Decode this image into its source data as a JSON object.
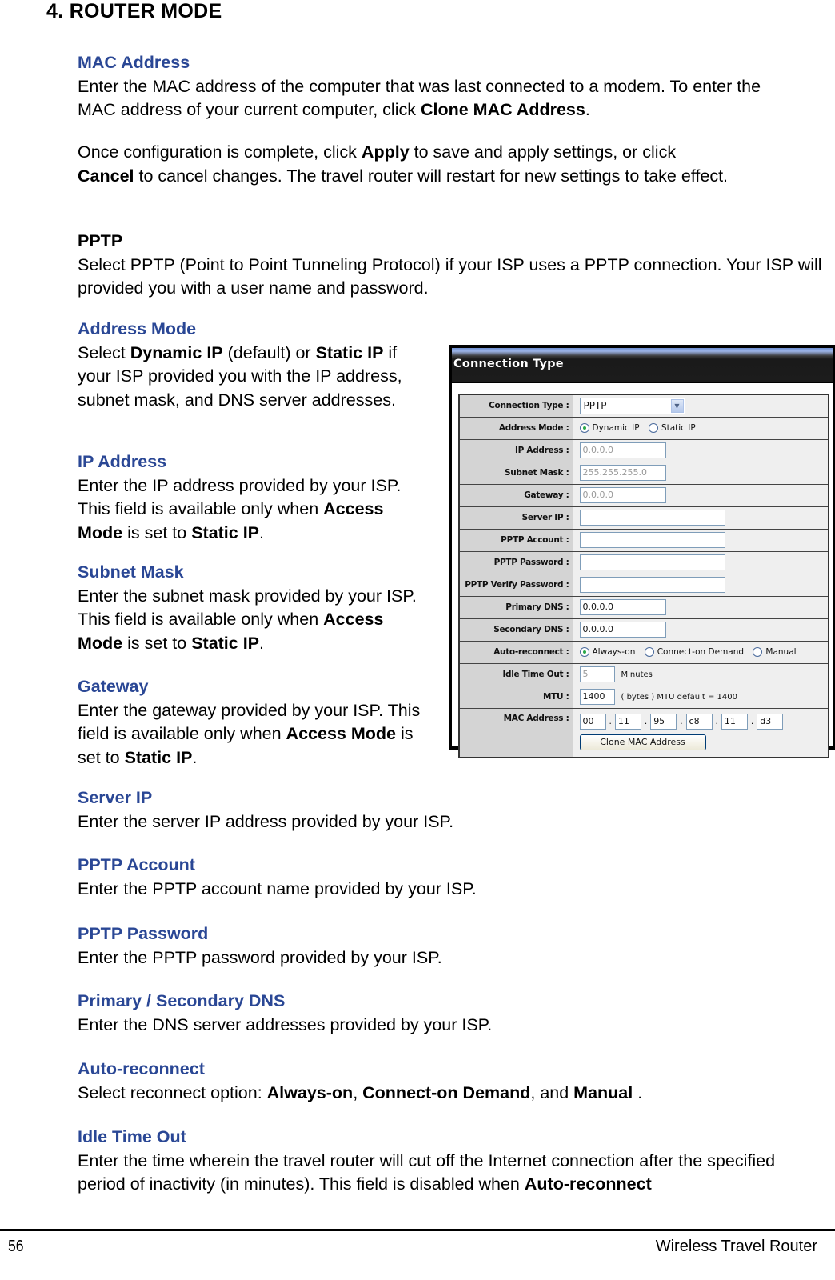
{
  "page_title": "4.  ROUTER MODE",
  "sections": {
    "mac": {
      "heading": "MAC Address",
      "text_1": "Enter the MAC address of the computer that was last connected to a modem. To enter the MAC address of your current computer, click ",
      "bold_1": "Clone MAC Address",
      "text_2": "."
    },
    "apply": {
      "text_1": "Once configuration is complete, click ",
      "bold_1": "Apply",
      "text_2": " to save and apply settings, or click ",
      "bold_2": "Cancel",
      "text_3": " to cancel changes. The travel router will restart for new settings to take effect."
    },
    "pptp": {
      "heading": "PPTP",
      "text": "Select PPTP (Point to Point Tunneling Protocol) if your ISP uses a PPTP connection. Your ISP will provided you with a user name and password."
    },
    "address_mode": {
      "heading": "Address Mode",
      "text_1": "Select ",
      "bold_1": "Dynamic IP",
      "text_2": " (default) or ",
      "bold_2": "Static IP",
      "text_3": " if your ISP provided you with the IP address, subnet mask, and DNS server addresses."
    },
    "ip_address": {
      "heading": "IP Address",
      "text_1": "Enter the IP address provided by your ISP. This field is available only when ",
      "bold_1": "Access Mode",
      "text_2": " is set to ",
      "bold_2": "Static IP",
      "text_3": "."
    },
    "subnet_mask": {
      "heading": "Subnet Mask",
      "text_1": "Enter the subnet mask provided by your ISP. This field is available only when ",
      "bold_1": "Access Mode",
      "text_2": " is set to ",
      "bold_2": "Static IP",
      "text_3": "."
    },
    "gateway": {
      "heading": "Gateway",
      "text_1": "Enter the gateway provided by your ISP. This field is available only when ",
      "bold_1": "Access Mode",
      "text_2": " is set to ",
      "bold_2": "Static IP",
      "text_3": "."
    },
    "server_ip": {
      "heading": "Server IP",
      "text": "Enter the server IP address provided by your ISP."
    },
    "pptp_account": {
      "heading": "PPTP Account",
      "text": "Enter the PPTP account name provided by your ISP."
    },
    "pptp_password": {
      "heading": "PPTP Password",
      "text": "Enter the PPTP password provided by your ISP."
    },
    "dns": {
      "heading": "Primary / Secondary DNS",
      "text": "Enter the DNS server addresses provided by your ISP."
    },
    "auto_reconnect": {
      "heading": "Auto-reconnect",
      "text_1": "Select reconnect option: ",
      "bold_1": "Always-on",
      "text_2": ", ",
      "bold_2": "Connect-on Demand",
      "text_3": ", and ",
      "bold_3": "Manual",
      "text_4": " ."
    },
    "idle_time_out": {
      "heading": "Idle Time Out",
      "text_1": "Enter the time wherein the travel router will cut off the Internet connection after the specified period of inactivity (in minutes). This field is disabled when ",
      "bold_1": "Auto-reconnect"
    }
  },
  "panel": {
    "title": "Connection Type",
    "connection_type": {
      "label": "Connection Type :",
      "value": "PPTP",
      "icon": "chevron-down-icon"
    },
    "address_mode": {
      "label": "Address Mode :",
      "options": [
        "Dynamic IP",
        "Static IP"
      ],
      "selected": "Dynamic IP"
    },
    "ip_address": {
      "label": "IP Address :",
      "value": "0.0.0.0"
    },
    "subnet_mask": {
      "label": "Subnet Mask :",
      "value": "255.255.255.0"
    },
    "gateway": {
      "label": "Gateway :",
      "value": "0.0.0.0"
    },
    "server_ip": {
      "label": "Server IP :",
      "value": ""
    },
    "pptp_account": {
      "label": "PPTP Account :",
      "value": ""
    },
    "pptp_password": {
      "label": "PPTP Password :",
      "value": ""
    },
    "pptp_verify_password": {
      "label": "PPTP Verify Password :",
      "value": ""
    },
    "primary_dns": {
      "label": "Primary DNS :",
      "value": "0.0.0.0"
    },
    "secondary_dns": {
      "label": "Secondary DNS :",
      "value": "0.0.0.0"
    },
    "auto_reconnect": {
      "label": "Auto-reconnect :",
      "options": [
        "Always-on",
        "Connect-on Demand",
        "Manual"
      ],
      "selected": "Always-on"
    },
    "idle_time_out": {
      "label": "Idle Time Out :",
      "value": "5",
      "unit": "Minutes"
    },
    "mtu": {
      "label": "MTU :",
      "value": "1400",
      "note": "( bytes ) MTU default = 1400"
    },
    "mac_address": {
      "label": "MAC Address :",
      "octets": [
        "00",
        "11",
        "95",
        "c8",
        "11",
        "d3"
      ],
      "separator": ".",
      "clone_button": "Clone MAC Address"
    }
  },
  "footer": {
    "page_number": "56",
    "title": "Wireless Travel Router"
  }
}
